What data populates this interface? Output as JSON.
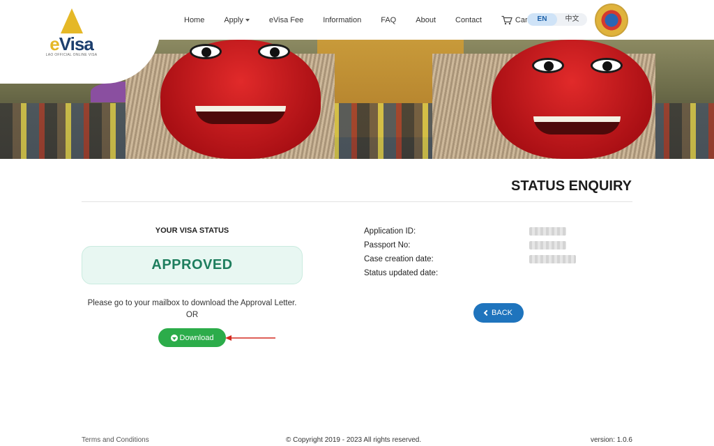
{
  "brand": {
    "logo_text_prefix": "e",
    "logo_text": "Visa",
    "logo_subtitle": "LAO OFFICIAL ONLINE VISA"
  },
  "nav": {
    "items": [
      {
        "label": "Home"
      },
      {
        "label": "Apply"
      },
      {
        "label": "eVisa Fee"
      },
      {
        "label": "Information"
      },
      {
        "label": "FAQ"
      },
      {
        "label": "About"
      },
      {
        "label": "Contact"
      }
    ],
    "cart_label": "Cart",
    "languages": [
      {
        "label": "EN",
        "active": true
      },
      {
        "label": "中文",
        "active": false
      }
    ]
  },
  "page": {
    "title": "STATUS ENQUIRY"
  },
  "status": {
    "heading": "YOUR VISA STATUS",
    "value": "APPROVED",
    "note": "Please go to your mailbox to download the Approval Letter.",
    "or_text": "OR",
    "download_label": "Download"
  },
  "application": {
    "fields": [
      {
        "label": "Application ID:"
      },
      {
        "label": "Passport No:"
      },
      {
        "label": "Case creation date:"
      },
      {
        "label": "Status updated date:"
      }
    ],
    "back_label": "BACK"
  },
  "footer": {
    "terms": "Terms and Conditions",
    "copyright": "© Copyright 2019 - 2023 All rights reserved.",
    "version": "version: 1.0.6"
  },
  "colors": {
    "approved_text": "#1e7e5e",
    "approved_bg": "#e8f7f2",
    "download_button": "#2cac4a",
    "back_button": "#1f74bd",
    "annotation_arrow": "#d42a20"
  }
}
